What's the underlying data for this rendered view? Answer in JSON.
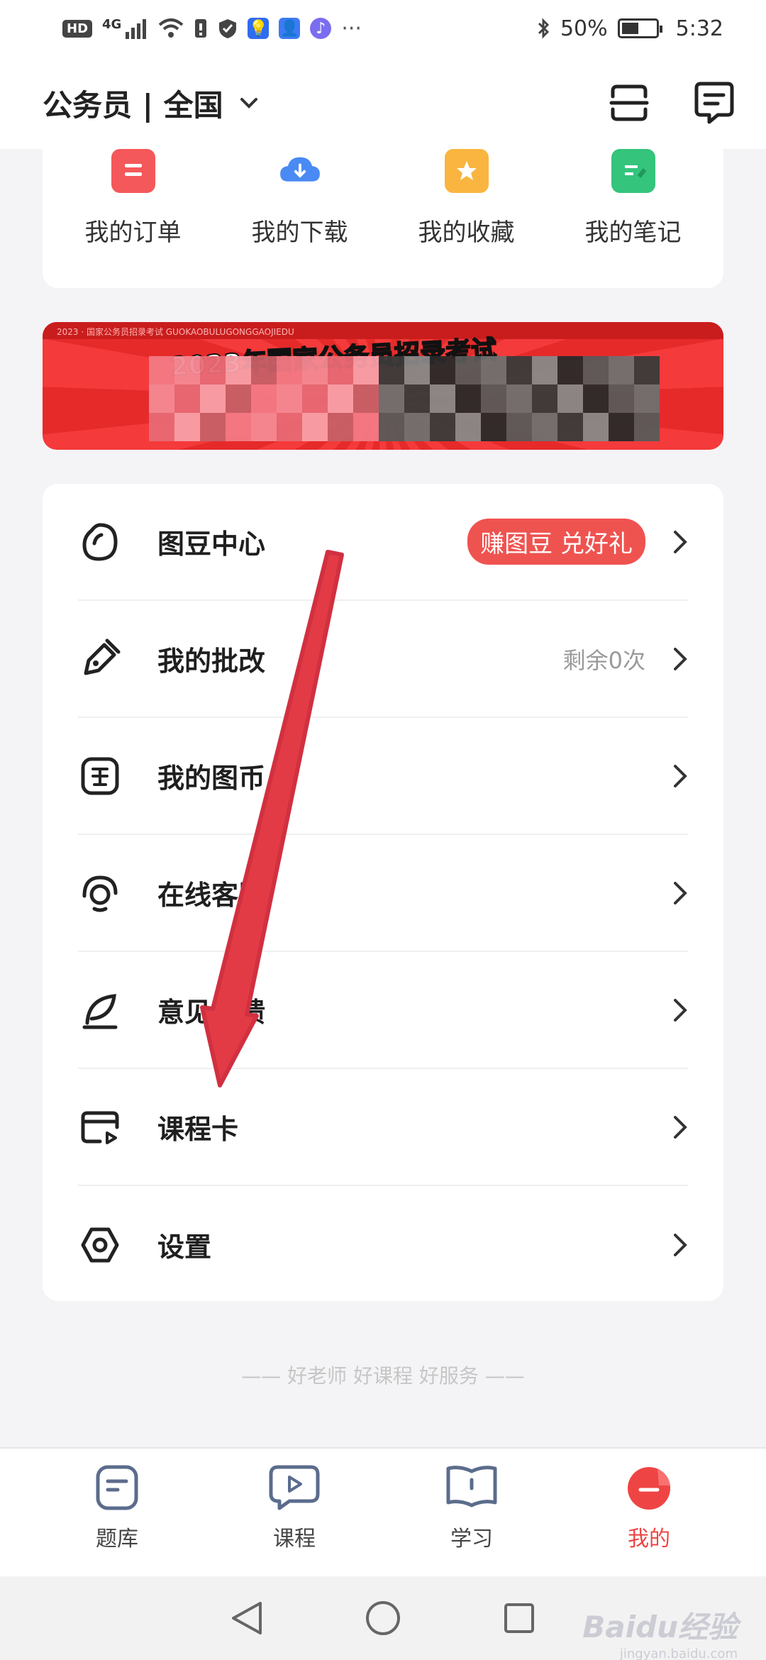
{
  "status_bar": {
    "left_badges": [
      "HD",
      "4G"
    ],
    "battery_percent": "50%",
    "time": "5:32",
    "battery_level": 0.5
  },
  "header": {
    "exam_selector": "公务员 | 全国",
    "actions": [
      "scan-icon",
      "message-icon"
    ]
  },
  "quick_links": [
    {
      "label": "我的订单",
      "icon": "order-icon",
      "color": "#f4585a"
    },
    {
      "label": "我的下载",
      "icon": "download-icon",
      "color": "#4a8af4"
    },
    {
      "label": "我的收藏",
      "icon": "star-icon",
      "color": "#f9b540"
    },
    {
      "label": "我的笔记",
      "icon": "note-icon",
      "color": "#34c47c"
    }
  ],
  "banner": {
    "strip_text": "2023 · 国家公务员招录考试  GUOKAOBULUGONGGAOJIEDU",
    "title": "2023年国家公务员招录考试"
  },
  "menu": [
    {
      "label": "图豆中心",
      "icon": "bean-icon",
      "badge": "赚图豆 兑好礼",
      "extra": ""
    },
    {
      "label": "我的批改",
      "icon": "pen-icon",
      "badge": "",
      "extra": "剩余0次"
    },
    {
      "label": "我的图币",
      "icon": "coin-icon",
      "badge": "",
      "extra": ""
    },
    {
      "label": "在线客服",
      "icon": "headset-icon",
      "badge": "",
      "extra": ""
    },
    {
      "label": "意见反馈",
      "icon": "feather-icon",
      "badge": "",
      "extra": ""
    },
    {
      "label": "课程卡",
      "icon": "card-icon",
      "badge": "",
      "extra": ""
    },
    {
      "label": "设置",
      "icon": "settings-icon",
      "badge": "",
      "extra": ""
    }
  ],
  "slogan": "—— 好老师 好课程 好服务 ——",
  "tabs": [
    {
      "label": "题库",
      "icon": "question-bank-icon",
      "active": false
    },
    {
      "label": "课程",
      "icon": "play-icon",
      "active": false
    },
    {
      "label": "学习",
      "icon": "book-icon",
      "active": false
    },
    {
      "label": "我的",
      "icon": "profile-icon",
      "active": true
    }
  ],
  "colors": {
    "accent": "#ef4444",
    "banner_red": "#f43a3a",
    "annotation_arrow": "#e23b45"
  },
  "watermark": {
    "text": "Baidu经验",
    "sub": "jingyan.baidu.com"
  }
}
